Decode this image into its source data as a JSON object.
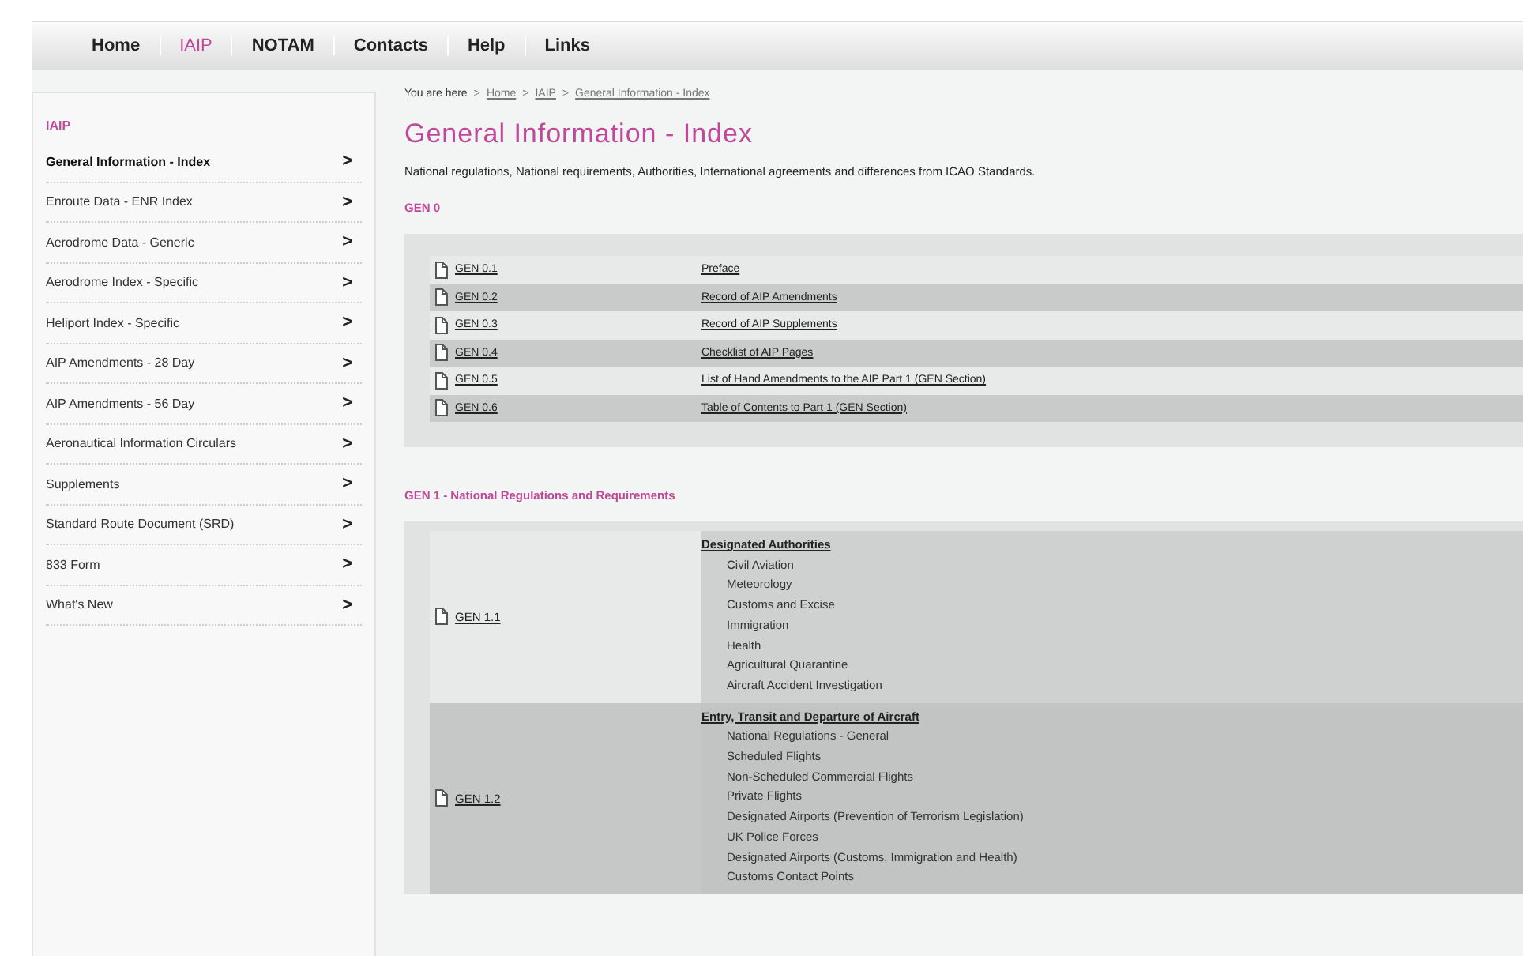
{
  "nav": [
    {
      "label": "Home",
      "selected": false
    },
    {
      "label": "IAIP",
      "selected": true
    },
    {
      "label": "NOTAM",
      "selected": false
    },
    {
      "label": "Contacts",
      "selected": false
    },
    {
      "label": "Help",
      "selected": false
    },
    {
      "label": "Links",
      "selected": false
    }
  ],
  "sidebar": {
    "heading": "IAIP",
    "items": [
      {
        "label": "General Information - Index",
        "arrow": ">",
        "selected": true
      },
      {
        "label": "Enroute Data - ENR Index",
        "arrow": ">",
        "selected": false
      },
      {
        "label": "Aerodrome Data - Generic",
        "arrow": ">",
        "selected": false
      },
      {
        "label": "Aerodrome Index - Specific",
        "arrow": ">",
        "selected": false
      },
      {
        "label": "Heliport Index - Specific",
        "arrow": ">",
        "selected": false
      },
      {
        "label": "AIP Amendments - 28 Day",
        "arrow": ">",
        "selected": false
      },
      {
        "label": "AIP Amendments - 56 Day",
        "arrow": ">",
        "selected": false
      },
      {
        "label": "Aeronautical Information Circulars",
        "arrow": ">",
        "selected": false
      },
      {
        "label": "Supplements",
        "arrow": ">",
        "selected": false
      },
      {
        "label": "Standard Route Document (SRD)",
        "arrow": ">",
        "selected": false
      },
      {
        "label": "833 Form",
        "arrow": ">",
        "selected": false
      },
      {
        "label": "What's New",
        "arrow": ">",
        "selected": false
      }
    ]
  },
  "breadcrumb": {
    "prefix": "You are here",
    "separator": ">",
    "links": [
      "Home",
      "IAIP",
      "General Information - Index"
    ]
  },
  "title": "General Information - Index",
  "intro": "National regulations, National requirements, Authorities, International agreements and differences from ICAO Standards.",
  "sections": [
    {
      "heading": "GEN 0",
      "kind": "simple",
      "rows": [
        {
          "code": "GEN 0.1",
          "title": "Preface"
        },
        {
          "code": "GEN 0.2",
          "title": "Record of AIP Amendments"
        },
        {
          "code": "GEN 0.3",
          "title": "Record of AIP Supplements"
        },
        {
          "code": "GEN 0.4",
          "title": "Checklist of AIP Pages"
        },
        {
          "code": "GEN 0.5",
          "title": "List of Hand Amendments to the AIP Part 1 (GEN Section)"
        },
        {
          "code": "GEN 0.6",
          "title": "Table of Contents to Part 1 (GEN Section)"
        }
      ]
    },
    {
      "heading": "GEN 1 - National Regulations and Requirements",
      "kind": "detailed",
      "rows": [
        {
          "code": "GEN 1.1",
          "title": "Designated Authorities",
          "subitems": [
            "Civil Aviation",
            "Meteorology",
            "Customs and Excise",
            "Immigration",
            "Health",
            "Agricultural Quarantine",
            "Aircraft Accident Investigation"
          ]
        },
        {
          "code": "GEN 1.2",
          "title": "Entry, Transit and Departure of Aircraft",
          "subitems": [
            "National Regulations - General",
            "Scheduled Flights",
            "Non-Scheduled Commercial Flights",
            "Private Flights",
            "Designated Airports (Prevention of Terrorism Legislation)",
            "UK Police Forces",
            "Designated Airports (Customs, Immigration and Health)",
            "Customs Contact Points"
          ]
        }
      ]
    }
  ]
}
